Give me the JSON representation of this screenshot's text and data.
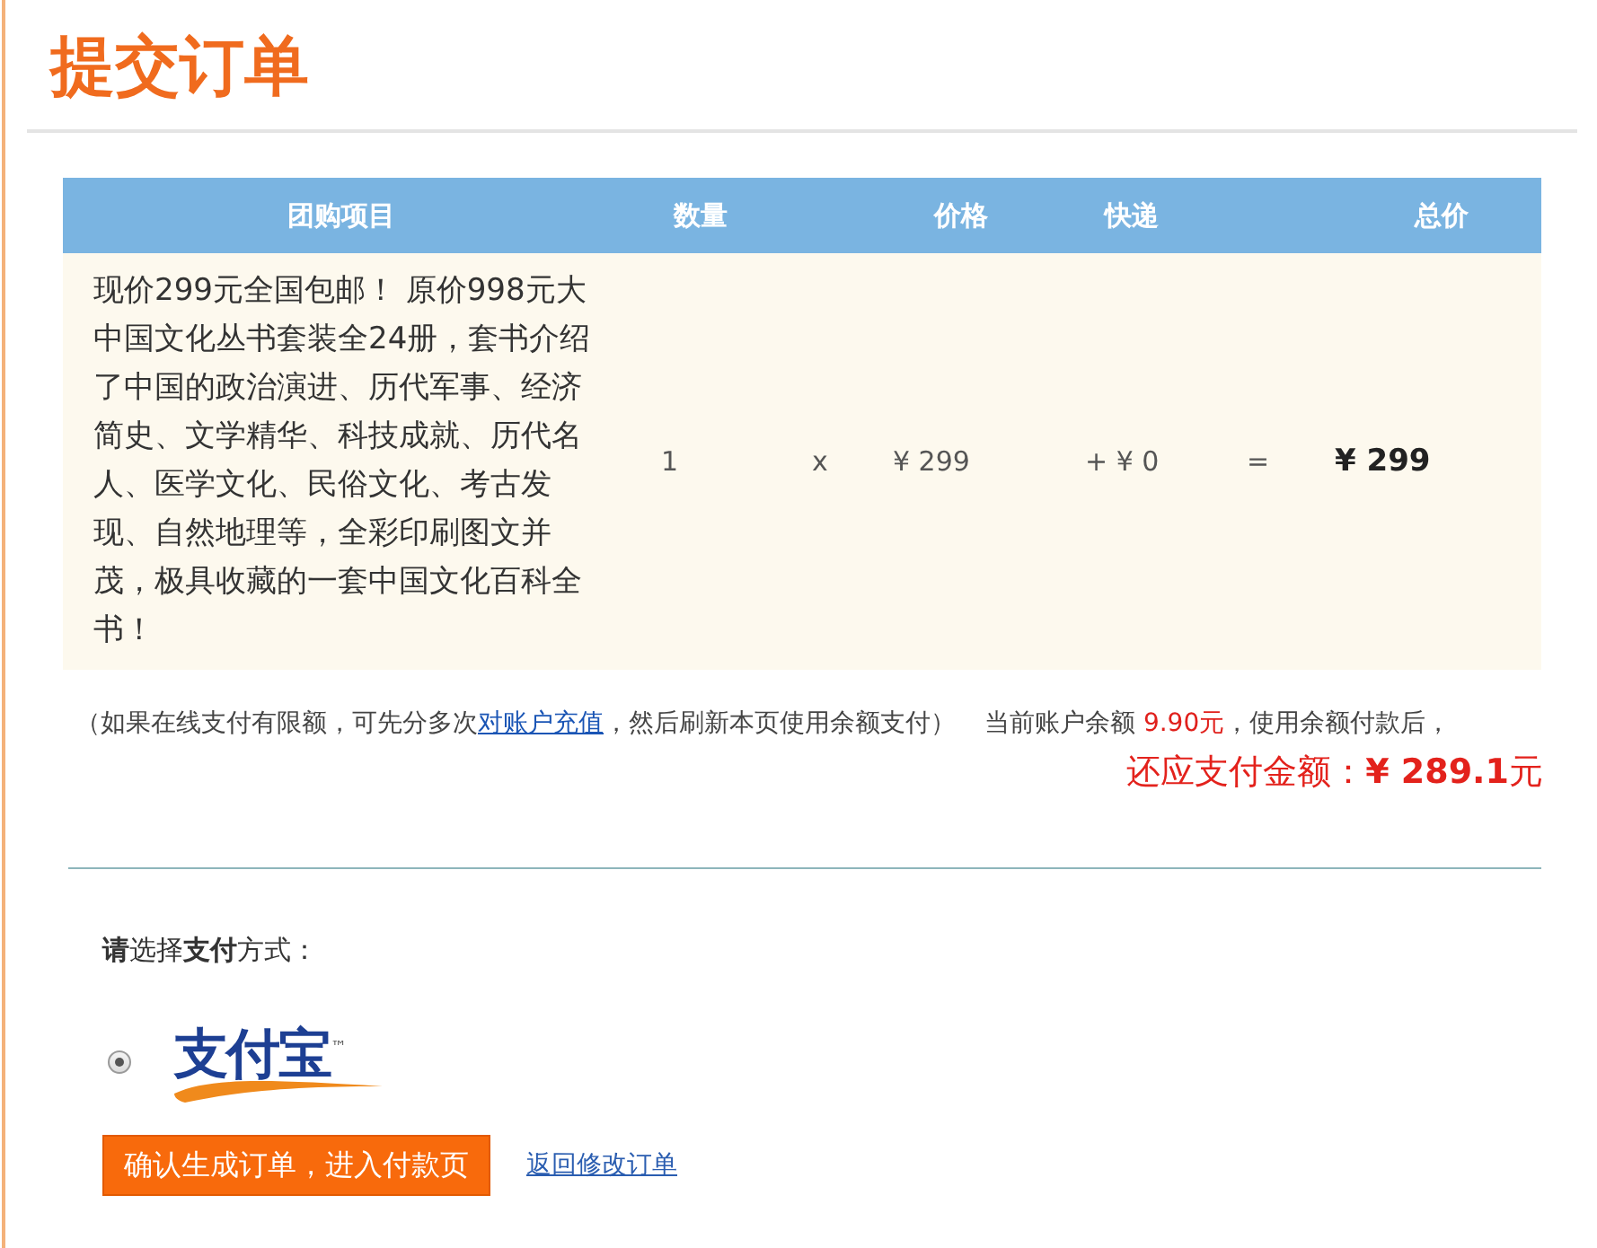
{
  "page": {
    "title": "提交订单"
  },
  "order_table": {
    "columns": [
      "团购项目",
      "数量",
      "价格",
      "快递",
      "总价"
    ],
    "rows": [
      {
        "item": "现价299元全国包邮！ 原价998元大中国文化丛书套装全24册，套书介绍了中国的政治演进、历代军事、经济简史、文学精华、科技成就、历代名人、医学文化、民俗文化、考古发现、自然地理等，全彩印刷图文并茂，极具收藏的一套中国文化百科全书！",
        "quantity": "1",
        "times": "x",
        "price": "¥ 299",
        "shipping": "+ ¥ 0",
        "equals": "=",
        "total": "¥ 299"
      }
    ]
  },
  "note": {
    "before_link": "（如果在线支付有限额，可先分多次",
    "link": "对账户充值",
    "after_link": "，然后刷新本页使用余额支付）"
  },
  "balance": {
    "label": "当前账户余额",
    "amount": "9.90元",
    "after": "，使用余额付款后，"
  },
  "amount_due": "还应支付金额：**¥ 289.1**元",
  "payment": {
    "prompt": "**请**选择**支付**方式：",
    "options": [
      {
        "logo": "支付宝$^{™}$",
        "selected": true
      }
    ]
  },
  "buttons": [
    {
      "kind": "primary",
      "label": "确认生成订单，进入付款页"
    },
    {
      "kind": "link",
      "label": "返回修改订单"
    }
  ]
}
